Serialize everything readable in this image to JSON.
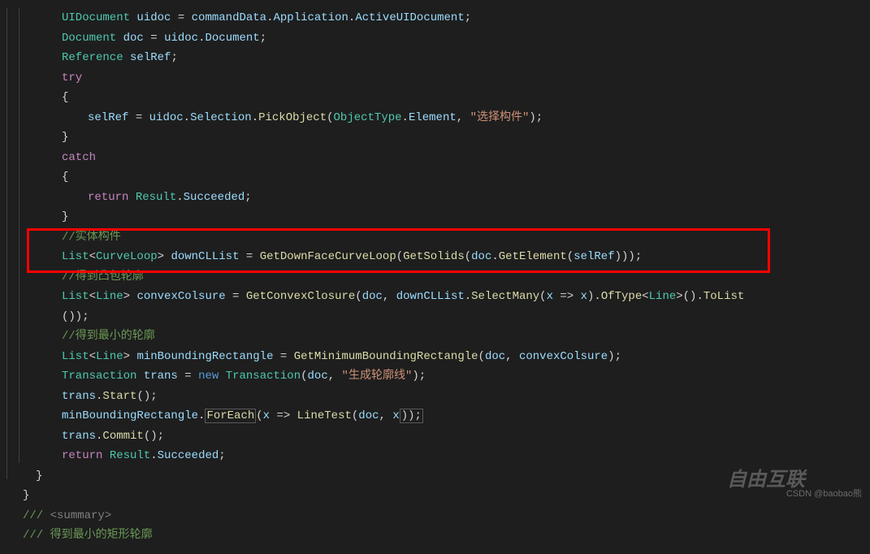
{
  "code": {
    "line1": {
      "type": "UIDocument",
      "var": "uidoc",
      "eq": " = ",
      "obj": "commandData",
      "dot1": ".",
      "prop1": "Application",
      "dot2": ".",
      "prop2": "ActiveUIDocument",
      "semi": ";"
    },
    "line2": {
      "type": "Document",
      "var": "doc",
      "eq": " = ",
      "obj": "uidoc",
      "dot": ".",
      "prop": "Document",
      "semi": ";"
    },
    "line3": {
      "type": "Reference",
      "var": "selRef",
      "semi": ";"
    },
    "line4": {
      "kw": "try"
    },
    "line5": {
      "brace": "{"
    },
    "line6": {
      "var": "selRef",
      "eq": " = ",
      "obj": "uidoc",
      "dot1": ".",
      "prop1": "Selection",
      "dot2": ".",
      "method": "PickObject",
      "paren1": "(",
      "enum": "ObjectType",
      "dot3": ".",
      "val": "Element",
      "comma": ", ",
      "str": "\"选择构件\"",
      "paren2": ")",
      "semi": ";"
    },
    "line7": {
      "brace": "}"
    },
    "line8": {
      "kw": "catch"
    },
    "line9": {
      "brace": "{"
    },
    "line10": {
      "kw": "return",
      "sp": " ",
      "type": "Result",
      "dot": ".",
      "val": "Succeeded",
      "semi": ";"
    },
    "line11": {
      "brace": "}"
    },
    "line12": {
      "comment": "//实体构件"
    },
    "line13": {
      "type1": "List",
      "lt": "<",
      "type2": "CurveLoop",
      "gt": "> ",
      "var": "downCLList",
      "eq": " = ",
      "m1": "GetDownFaceCurveLoop",
      "p1": "(",
      "m2": "GetSolids",
      "p2": "(",
      "obj": "doc",
      "dot": ".",
      "m3": "GetElement",
      "p3": "(",
      "arg": "selRef",
      "close": ")));"
    },
    "line14": {
      "comment": "//得到凸包轮廓"
    },
    "line15": {
      "type1": "List",
      "lt": "<",
      "type2": "Line",
      "gt": "> ",
      "var": "convexColsure",
      "eq": " = ",
      "m1": "GetConvexClosure",
      "p1": "(",
      "a1": "doc",
      "c1": ", ",
      "a2": "downCLList",
      "dot1": ".",
      "m2": "SelectMany",
      "p2": "(",
      "lam1": "x",
      "arrow": " => ",
      "lam2": "x",
      "p3": ").",
      "m3": "OfType",
      "lt2": "<",
      "type3": "Line",
      "gt2": ">().",
      "m4": "ToList"
    },
    "line15b": {
      "close": "());"
    },
    "line16": {
      "comment": "//得到最小的轮廓"
    },
    "line17": {
      "type1": "List",
      "lt": "<",
      "type2": "Line",
      "gt": "> ",
      "var": "minBoundingRectangle",
      "eq": " = ",
      "m1": "GetMinimumBoundingRectangle",
      "p1": "(",
      "a1": "doc",
      "c1": ", ",
      "a2": "convexColsure",
      "close": ");"
    },
    "line18": {
      "type": "Transaction",
      "var": "trans",
      "eq": " = ",
      "kw": "new",
      "sp": " ",
      "ctor": "Transaction",
      "p1": "(",
      "a1": "doc",
      "c1": ", ",
      "str": "\"生成轮廓线\"",
      "close": ");"
    },
    "line19": {
      "obj": "trans",
      "dot": ".",
      "m": "Start",
      "close": "();"
    },
    "line20": {
      "obj": "minBoundingRectangle",
      "dot": ".",
      "m": "ForEach",
      "p1": "(",
      "lam": "x",
      "arrow": " => ",
      "m2": "LineTest",
      "p2": "(",
      "a1": "doc",
      "c1": ", ",
      "a2": "x",
      "close": "));"
    },
    "line21": {
      "obj": "trans",
      "dot": ".",
      "m": "Commit",
      "close": "();"
    },
    "line22": {
      "kw": "return",
      "sp": " ",
      "type": "Result",
      "dot": ".",
      "val": "Succeeded",
      "semi": ";"
    },
    "line23": {
      "brace": "}"
    },
    "line24": {
      "brace": "}"
    },
    "line25": {
      "c1": "/// ",
      "c2": "<summary>"
    },
    "line26": {
      "comment": "/// 得到最小的矩形轮廓"
    }
  },
  "watermark": {
    "site": "自由互联",
    "credit": "CSDN @baobao熊"
  }
}
